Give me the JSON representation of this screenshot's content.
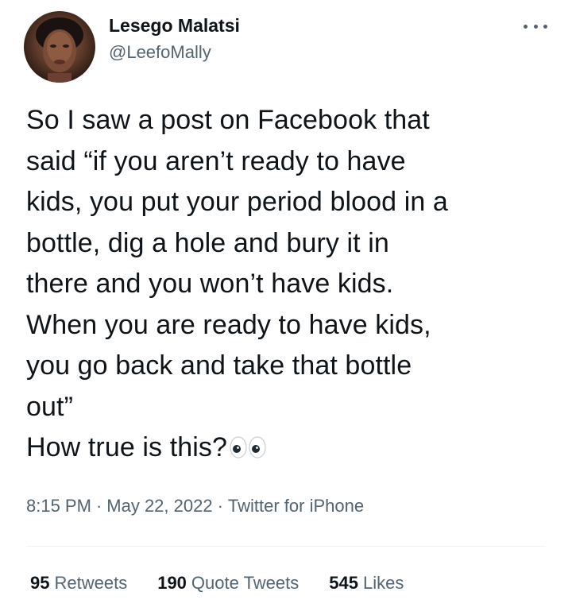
{
  "author": {
    "display_name": "Lesego Malatsi",
    "handle": "@LeefoMally"
  },
  "tweet": {
    "text": "So I saw a post on Facebook that\nsaid “if you aren’t ready to have\nkids, you put your period blood in a\nbottle, dig a hole and bury it in\nthere and you won’t have kids.\nWhen you are ready to have kids,\nyou go back and take that bottle\nout”\nHow true is this?",
    "emoji_icon": "eyes-icon"
  },
  "meta": {
    "time": "8:15 PM",
    "date": "May 22, 2022",
    "source": "Twitter for iPhone",
    "separator": "·"
  },
  "stats": {
    "retweets_count": "95",
    "retweets_label": "Retweets",
    "quotes_count": "190",
    "quotes_label": "Quote Tweets",
    "likes_count": "545",
    "likes_label": "Likes"
  },
  "colors": {
    "text_primary": "#0f1419",
    "text_secondary": "#536471",
    "divider": "#eff3f4"
  }
}
